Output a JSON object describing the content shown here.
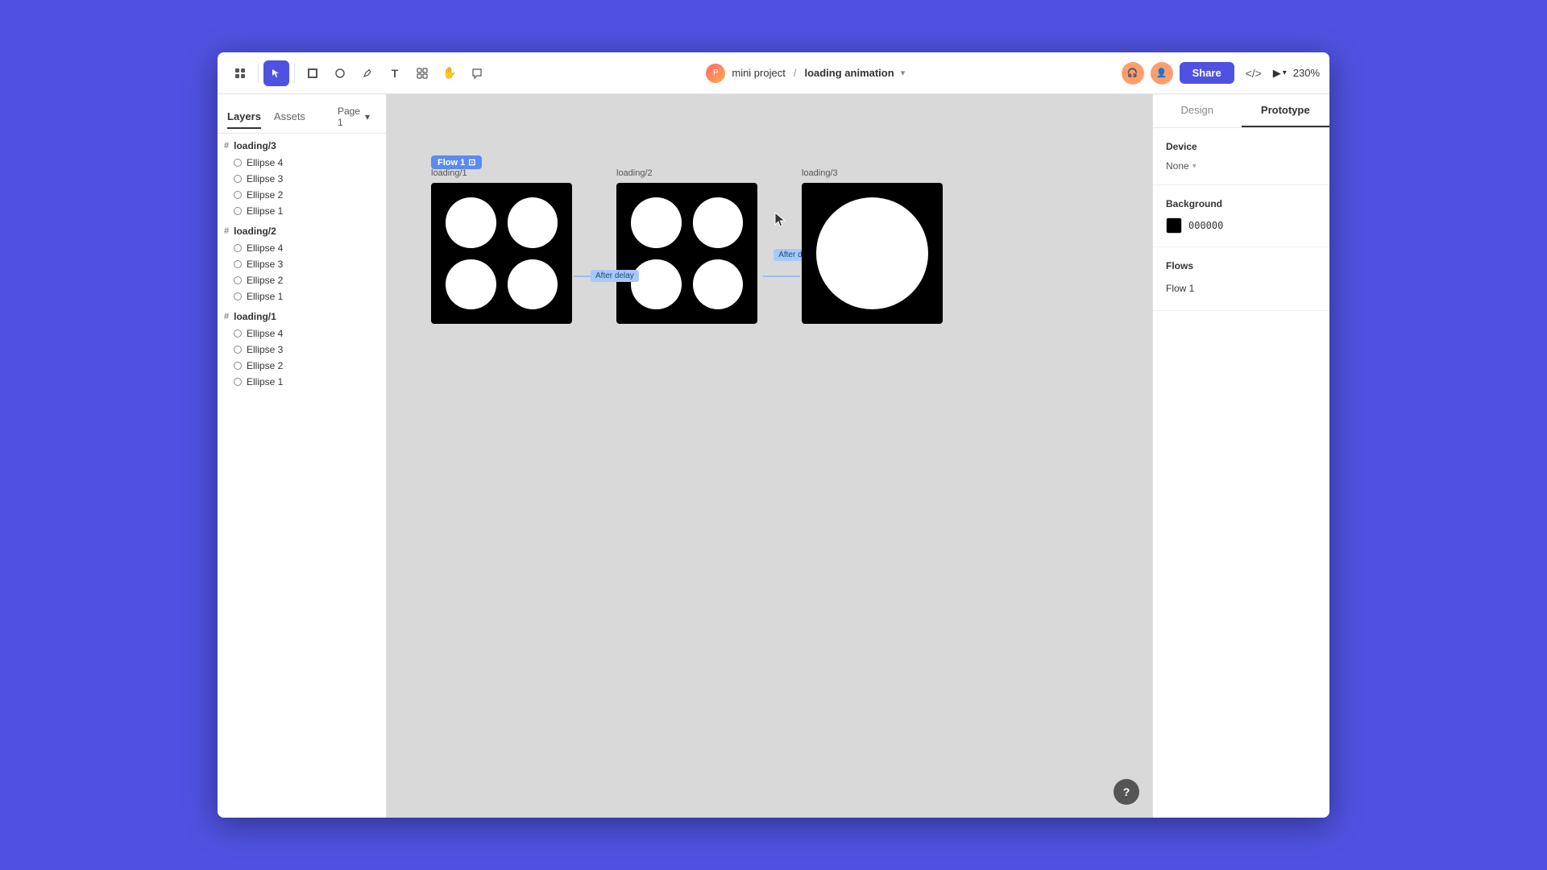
{
  "window": {
    "background": "#4f52e0"
  },
  "topbar": {
    "project_name": "mini project",
    "file_name": "loading animation",
    "separator": "/",
    "share_label": "Share",
    "zoom_label": "230%",
    "tools": [
      {
        "id": "menu",
        "icon": "#",
        "label": "menu-icon"
      },
      {
        "id": "select",
        "icon": "▶",
        "label": "select-tool",
        "active": true
      },
      {
        "id": "frame",
        "icon": "⬜",
        "label": "frame-tool"
      },
      {
        "id": "shape",
        "icon": "○",
        "label": "shape-tool"
      },
      {
        "id": "pen",
        "icon": "✏",
        "label": "pen-tool"
      },
      {
        "id": "text",
        "icon": "T",
        "label": "text-tool"
      },
      {
        "id": "component",
        "icon": "⊞",
        "label": "component-tool"
      },
      {
        "id": "hand",
        "icon": "✋",
        "label": "hand-tool"
      },
      {
        "id": "comment",
        "icon": "💬",
        "label": "comment-tool"
      }
    ]
  },
  "sidebar": {
    "tabs": [
      {
        "id": "layers",
        "label": "Layers",
        "active": true
      },
      {
        "id": "assets",
        "label": "Assets",
        "active": false
      }
    ],
    "page": "Page 1",
    "layers": [
      {
        "id": "loading3",
        "label": "loading/3",
        "children": [
          "Ellipse 4",
          "Ellipse 3",
          "Ellipse 2",
          "Ellipse 1"
        ]
      },
      {
        "id": "loading2",
        "label": "loading/2",
        "children": [
          "Ellipse 4",
          "Ellipse 3",
          "Ellipse 2",
          "Ellipse 1"
        ]
      },
      {
        "id": "loading1",
        "label": "loading/1",
        "children": [
          "Ellipse 4",
          "Ellipse 3",
          "Ellipse 2",
          "Ellipse 1"
        ]
      }
    ]
  },
  "canvas": {
    "frames": [
      {
        "id": "loading1",
        "label": "loading/1",
        "type": "four-circles",
        "flow_tag": "Flow 1"
      },
      {
        "id": "loading2",
        "label": "loading/2",
        "type": "four-circles",
        "after_delay": "After delay"
      },
      {
        "id": "loading3",
        "label": "loading/3",
        "type": "single-circle",
        "after_delay": "After delay"
      }
    ],
    "connectors": [
      {
        "from": "loading1",
        "to": "loading2",
        "label": "After delay"
      },
      {
        "from": "loading2",
        "to": "loading3",
        "label": "After delay"
      }
    ]
  },
  "right_panel": {
    "tabs": [
      {
        "id": "design",
        "label": "Design",
        "active": false
      },
      {
        "id": "prototype",
        "label": "Prototype",
        "active": true
      }
    ],
    "device_section": {
      "title": "Device",
      "value": "None"
    },
    "background_section": {
      "title": "Background",
      "color": "#000000",
      "color_label": "000000"
    },
    "flows_section": {
      "title": "Flows",
      "items": [
        "Flow 1"
      ]
    }
  },
  "help_btn": "?"
}
